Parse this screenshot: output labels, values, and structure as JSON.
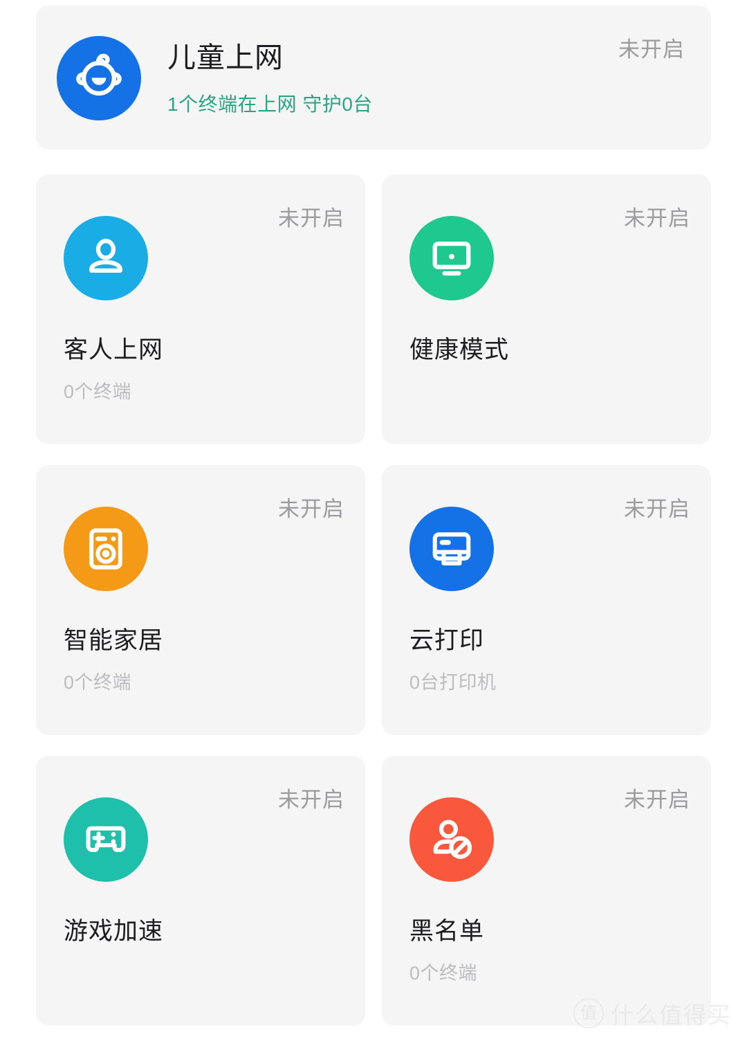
{
  "hero": {
    "title": "儿童上网",
    "subtitle": "1个终端在上网  守护0台",
    "status": "未开启",
    "icon": "baby-face-icon",
    "icon_color": "#1472e6",
    "subtitle_color": "#2aa383",
    "status_color": "#9b9b9d"
  },
  "tiles": [
    {
      "title": "客人上网",
      "subtitle": "0个终端",
      "status": "未开启",
      "icon": "person-icon",
      "icon_color": "#1aade5"
    },
    {
      "title": "健康模式",
      "subtitle": "",
      "status": "未开启",
      "icon": "monitor-icon",
      "icon_color": "#1fc88e"
    },
    {
      "title": "智能家居",
      "subtitle": "0个终端",
      "status": "未开启",
      "icon": "washing-machine-icon",
      "icon_color": "#f59a16"
    },
    {
      "title": "云打印",
      "subtitle": "0台打印机",
      "status": "未开启",
      "icon": "printer-icon",
      "icon_color": "#1472e6"
    },
    {
      "title": "游戏加速",
      "subtitle": "",
      "status": "未开启",
      "icon": "gamepad-icon",
      "icon_color": "#1ec0ab"
    },
    {
      "title": "黑名单",
      "subtitle": "0个终端",
      "status": "未开启",
      "icon": "person-blocked-icon",
      "icon_color": "#f9583c"
    }
  ],
  "watermark": {
    "badge": "值",
    "text": "什么值得买"
  },
  "theme": {
    "page_background": "#ffffff",
    "card_background": "#f5f5f6",
    "title_color": "#1d1d1f",
    "subtitle_color": "#bcbcbe"
  }
}
